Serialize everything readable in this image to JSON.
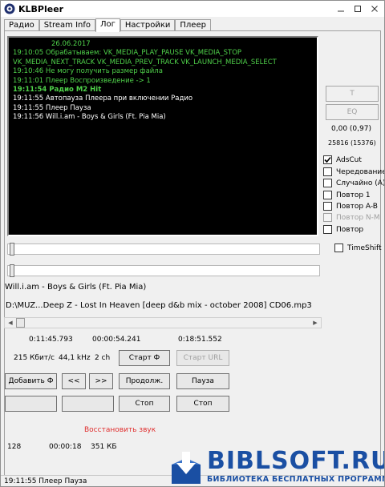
{
  "window": {
    "title": "KLBPleer",
    "minimize_icon": "minimize-icon",
    "maximize_icon": "maximize-icon",
    "close_icon": "close-icon"
  },
  "tabs": [
    {
      "label": "Радио"
    },
    {
      "label": "Stream Info"
    },
    {
      "label": "Лог",
      "active": true
    },
    {
      "label": "Настройки"
    },
    {
      "label": "Плеер"
    }
  ],
  "log": {
    "lines": [
      {
        "text": "26.06.2017",
        "color": "#4fd14a"
      },
      {
        "text": "19:10:05 Обрабатываем: VK_MEDIA_PLAY_PAUSE  VK_MEDIA_STOP",
        "color": "#4fd14a"
      },
      {
        "text": "VK_MEDIA_NEXT_TRACK  VK_MEDIA_PREV_TRACK  VK_LAUNCH_MEDIA_SELECT",
        "color": "#4fd14a"
      },
      {
        "text": "19:10:46 Не могу получить размер файла",
        "color": "#4fd14a"
      },
      {
        "text": "19:11:01 Плеер Воспроизведение -> 1",
        "color": "#4fd14a"
      },
      {
        "text": "19:11:54 Радио M2 Hit",
        "color": "#4fd14a"
      },
      {
        "text": "19:11:55 Автопауза Плеера при включении Радио",
        "color": "#ffffff"
      },
      {
        "text": "19:11:55 Плеер Пауза",
        "color": "#ffffff"
      },
      {
        "text": "19:11:56 Will.i.am - Boys & Girls (Ft. Pia Mia)",
        "color": "#ffffff"
      }
    ]
  },
  "side": {
    "t_button": "T",
    "eq_button": "EQ",
    "level_text": "0,00  (0,97)",
    "counter_text": "25816  (15376)",
    "checks": [
      {
        "label": "AdsCut",
        "checked": true,
        "enabled": true
      },
      {
        "label": "Чередование",
        "checked": false,
        "enabled": true
      },
      {
        "label": "Случайно (A)",
        "checked": false,
        "enabled": true
      },
      {
        "label": "Повтор 1",
        "checked": false,
        "enabled": true
      },
      {
        "label": "Повтор A-B",
        "checked": false,
        "enabled": true
      },
      {
        "label": "Повтор N-M",
        "checked": false,
        "enabled": false
      },
      {
        "label": "Повтор",
        "checked": false,
        "enabled": true
      }
    ],
    "timeshift_label": "TimeShift"
  },
  "player": {
    "track_title": "Will.i.am - Boys & Girls (Ft. Pia Mia)",
    "file_path": "D:\\MUZ...Deep Z - Lost In Heaven [deep d&b mix - october 2008] CD06.mp3",
    "position_fraction": 0.0,
    "time_elapsed": "0:11:45.793",
    "time_mid": "00:00:54.241",
    "time_total": "0:18:51.552",
    "bitrate": "215 Кбит/с",
    "samplerate": "44,1 kHz",
    "channels": "2 ch",
    "start_f_button": "Старт Ф",
    "start_url_button": "Старт URL",
    "add_f_button": "Добавить Ф",
    "prev_button": "<<",
    "next_button": ">>",
    "continue_button": "Продолж.",
    "pause_button": "Пауза",
    "stop_button_1": "Стоп",
    "stop_button_2": "Стоп",
    "restore_sound": "Восстановить звук",
    "stat_1": "128",
    "stat_2": "00:00:18",
    "stat_3": "351 КБ"
  },
  "status": {
    "text": "19:11:55 Плеер Пауза"
  },
  "watermark": {
    "main": "BIBLSOFT.RU",
    "sub": "БИБЛИОТЕКА БЕСПЛАТНЫХ ПРОГРАММ"
  }
}
